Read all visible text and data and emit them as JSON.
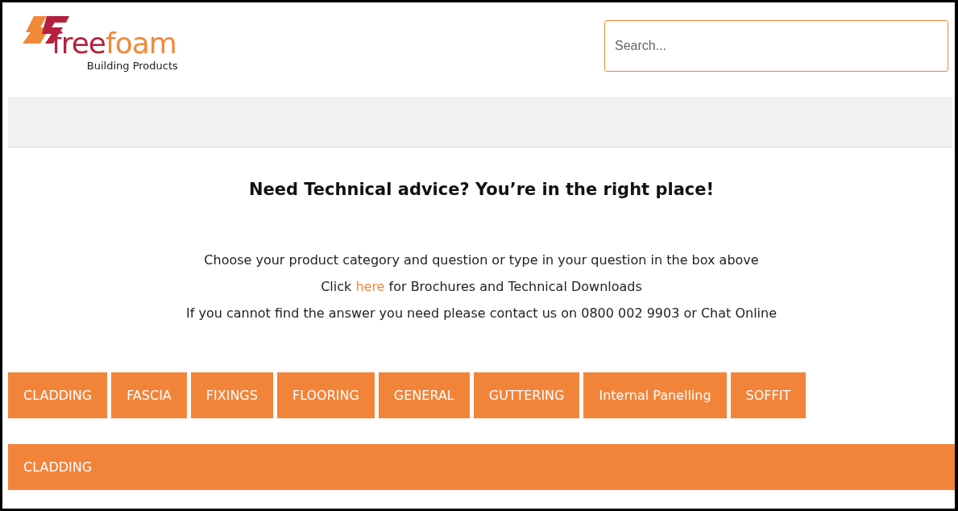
{
  "logo": {
    "word_1": "free",
    "word_2": "foam",
    "tagline": "Building Products"
  },
  "search": {
    "placeholder": "Search..."
  },
  "heading": "Need Technical advice? You’re in the right place!",
  "intro": [
    {
      "text": "Choose your product category and question or type in your question in the box above"
    },
    {
      "before": "Click",
      "link": "here",
      "after": "for Brochures and Technical Downloads"
    },
    {
      "text": "If you cannot find the answer you need please contact us on 0800 002 9903 or Chat Online"
    }
  ],
  "categories": [
    "CLADDING",
    "FASCIA",
    "FIXINGS",
    "FLOORING",
    "GENERAL",
    "GUTTERING",
    "Internal Panelling",
    "SOFFIT"
  ],
  "section": {
    "title": "CLADDING"
  }
}
